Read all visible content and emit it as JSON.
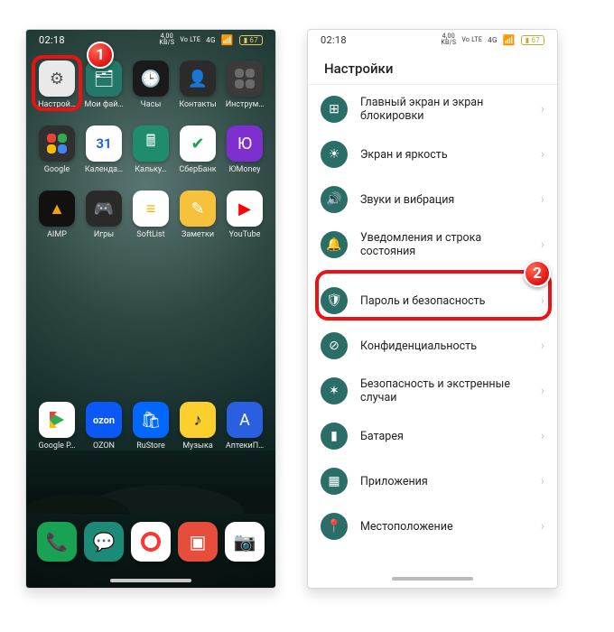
{
  "badges": {
    "one": "1",
    "two": "2"
  },
  "status": {
    "time": "02:18",
    "net_speed": "4,00",
    "net_unit": "KB/S",
    "volte": "Vo LTE",
    "sim": "4G",
    "battery": "67"
  },
  "home": {
    "apps": [
      {
        "key": "settings",
        "label": "Настрой…",
        "glyph": "⚙"
      },
      {
        "key": "files",
        "label": "Мои фай…",
        "glyph": "🗂"
      },
      {
        "key": "clock",
        "label": "Часы",
        "glyph": "🕒"
      },
      {
        "key": "contacts",
        "label": "Контакты",
        "glyph": "👤"
      },
      {
        "key": "tools",
        "label": "Инструм…",
        "glyph": ""
      },
      {
        "key": "google",
        "label": "Google",
        "glyph": ""
      },
      {
        "key": "calendar",
        "label": "Календа…",
        "glyph": "31"
      },
      {
        "key": "calc",
        "label": "Кальку…",
        "glyph": "🖩"
      },
      {
        "key": "sber",
        "label": "СберБанк",
        "glyph": "✔"
      },
      {
        "key": "umoney",
        "label": "ЮMoney",
        "glyph": "Ю"
      },
      {
        "key": "aimp",
        "label": "AIMP",
        "glyph": "▲"
      },
      {
        "key": "games",
        "label": "Игры",
        "glyph": "🎮"
      },
      {
        "key": "softlist",
        "label": "SoftList",
        "glyph": "≡"
      },
      {
        "key": "notes",
        "label": "Заметки",
        "glyph": "✎"
      },
      {
        "key": "youtube",
        "label": "YouTube",
        "glyph": "▶"
      },
      {
        "key": "play",
        "label": "Google P…",
        "glyph": ""
      },
      {
        "key": "ozon",
        "label": "OZON",
        "glyph": "ozon"
      },
      {
        "key": "rustore",
        "label": "RuStore",
        "glyph": "🛍"
      },
      {
        "key": "music",
        "label": "Музыка",
        "glyph": "♪"
      },
      {
        "key": "apteka",
        "label": "АптекиП…",
        "glyph": "А"
      }
    ],
    "dock": [
      {
        "key": "phone",
        "glyph": "📞"
      },
      {
        "key": "sms",
        "glyph": "💬"
      },
      {
        "key": "yandex",
        "glyph": ""
      },
      {
        "key": "gallery",
        "glyph": "▣"
      },
      {
        "key": "camera",
        "glyph": "📷"
      }
    ]
  },
  "settings": {
    "title": "Настройки",
    "items": [
      {
        "key": "home-lock",
        "label": "Главный экран и экран блокировки",
        "glyph": "⊞"
      },
      {
        "key": "display",
        "label": "Экран и яркость",
        "glyph": "☀"
      },
      {
        "key": "sound",
        "label": "Звуки и вибрация",
        "glyph": "🔊"
      },
      {
        "key": "notif",
        "label": "Уведомления и строка состояния",
        "glyph": "🔔"
      },
      {
        "key": "security",
        "label": "Пароль и безопасность",
        "glyph": "🛡"
      },
      {
        "key": "privacy",
        "label": "Конфиденциальность",
        "glyph": "⊘"
      },
      {
        "key": "emergency",
        "label": "Безопасность и экстренные случаи",
        "glyph": "✶"
      },
      {
        "key": "battery",
        "label": "Батарея",
        "glyph": "▮"
      },
      {
        "key": "apps",
        "label": "Приложения",
        "glyph": "▦"
      },
      {
        "key": "location",
        "label": "Местоположение",
        "glyph": "📍"
      }
    ]
  }
}
